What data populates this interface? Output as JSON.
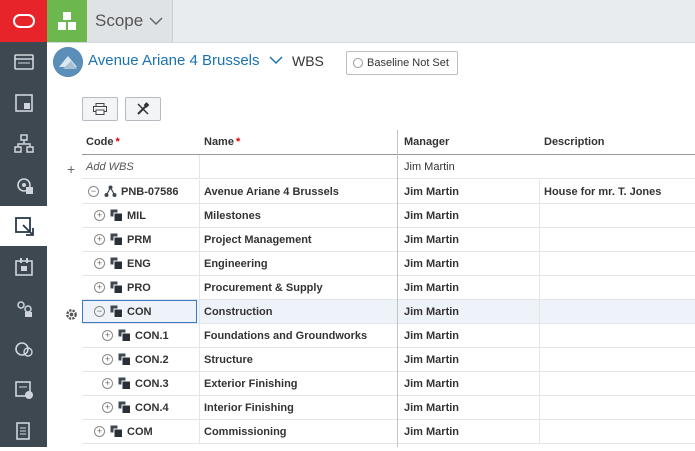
{
  "rail": {
    "items": [
      {
        "icon": "ledger-icon"
      },
      {
        "icon": "portfolio-icon"
      },
      {
        "icon": "hierarchy-icon"
      },
      {
        "icon": "resource-icon"
      },
      {
        "icon": "scope-icon",
        "active": true
      },
      {
        "icon": "calendar-icon"
      },
      {
        "icon": "team-icon"
      },
      {
        "icon": "risk-icon"
      },
      {
        "icon": "cost-icon"
      },
      {
        "icon": "document-icon"
      }
    ]
  },
  "topbar": {
    "module": "Scope"
  },
  "project": {
    "name": "Avenue Ariane 4 Brussels",
    "view": "WBS",
    "baseline": "Baseline Not Set"
  },
  "grid": {
    "columns": {
      "code": "Code",
      "name": "Name",
      "manager": "Manager",
      "description": "Description"
    },
    "add_row": {
      "placeholder": "Add WBS",
      "manager": "Jim Martin"
    },
    "rows": [
      {
        "toggle": "−",
        "icon": "project",
        "code": "PNB-07586",
        "name": "Avenue Ariane 4 Brussels",
        "manager": "Jim Martin",
        "description": "House for mr. T. Jones",
        "level": 0
      },
      {
        "toggle": "+",
        "icon": "wbs",
        "code": "MIL",
        "name": "Milestones",
        "manager": "Jim Martin",
        "description": "",
        "level": 1
      },
      {
        "toggle": "+",
        "icon": "wbs",
        "code": "PRM",
        "name": "Project Management",
        "manager": "Jim Martin",
        "description": "",
        "level": 1
      },
      {
        "toggle": "+",
        "icon": "wbs",
        "code": "ENG",
        "name": "Engineering",
        "manager": "Jim Martin",
        "description": "",
        "level": 1
      },
      {
        "toggle": "+",
        "icon": "wbs",
        "code": "PRO",
        "name": "Procurement & Supply",
        "manager": "Jim Martin",
        "description": "",
        "level": 1
      },
      {
        "toggle": "−",
        "icon": "wbs",
        "code": "CON",
        "name": "Construction",
        "manager": "Jim Martin",
        "description": "",
        "level": 1,
        "selected": true
      },
      {
        "toggle": "+",
        "icon": "wbs",
        "code": "CON.1",
        "name": "Foundations and Groundworks",
        "manager": "Jim Martin",
        "description": "",
        "level": 2
      },
      {
        "toggle": "+",
        "icon": "wbs",
        "code": "CON.2",
        "name": "Structure",
        "manager": "Jim Martin",
        "description": "",
        "level": 2
      },
      {
        "toggle": "+",
        "icon": "wbs",
        "code": "CON.3",
        "name": "Exterior Finishing",
        "manager": "Jim Martin",
        "description": "",
        "level": 2
      },
      {
        "toggle": "+",
        "icon": "wbs",
        "code": "CON.4",
        "name": "Interior Finishing",
        "manager": "Jim Martin",
        "description": "",
        "level": 2
      },
      {
        "toggle": "+",
        "icon": "wbs",
        "code": "COM",
        "name": "Commissioning",
        "manager": "Jim Martin",
        "description": "",
        "level": 1
      }
    ]
  },
  "colors": {
    "rail": "#3e4851",
    "brand": "#e8242b",
    "app_tile": "#6cb84e",
    "link": "#1a73b0",
    "selection": "#3a7bc8"
  }
}
